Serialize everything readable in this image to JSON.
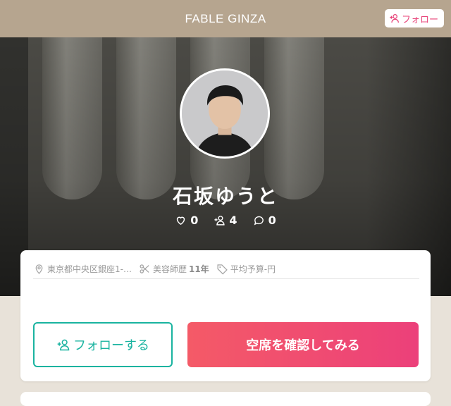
{
  "header": {
    "salon_name": "FABLE GINZA",
    "follow_label": "フォロー"
  },
  "profile": {
    "name": "石坂ゆうと",
    "stats": {
      "likes": "0",
      "followers": "4",
      "comments": "0"
    }
  },
  "info": {
    "address": "東京都中央区銀座1-…",
    "experience_prefix": "美容師歴",
    "experience_years": "11年",
    "budget": "平均予算-円"
  },
  "actions": {
    "follow_label": "フォローする",
    "reserve_label": "空席を確認してみる"
  },
  "colors": {
    "header_bg": "#b6a58f",
    "accent_pink": "#e8457a",
    "follow_teal": "#19b3a0",
    "reserve_gradient_start": "#f45a67",
    "reserve_gradient_end": "#ec407a"
  }
}
